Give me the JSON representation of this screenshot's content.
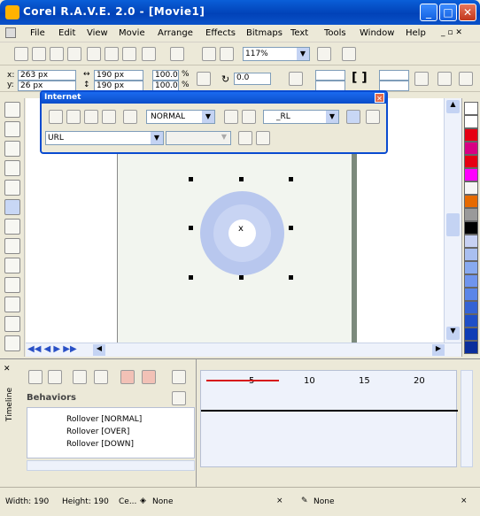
{
  "app": {
    "title": "Corel R.A.V.E. 2.0 - [Movie1]"
  },
  "menu": [
    "File",
    "Edit",
    "View",
    "Movie",
    "Arrange",
    "Effects",
    "Bitmaps",
    "Text",
    "Tools",
    "Window",
    "Help"
  ],
  "toolbar": {
    "zoom": "117%"
  },
  "props": {
    "x": "263 px",
    "y": "26 px",
    "width": "190 px",
    "height": "190 px",
    "scale_x": "100.0",
    "scale_y": "100.0",
    "rotation": "0.0",
    "pct": "%"
  },
  "internet": {
    "title": "Internet",
    "state": "NORMAL",
    "url_type": "URL",
    "url_placeholder": "URL",
    "target": "_RL"
  },
  "timeline": {
    "label": "Timeline",
    "section": "Behaviors",
    "ticks": [
      "5",
      "10",
      "15",
      "20"
    ],
    "rows": [
      "Rollover [NORMAL]",
      "Rollover [OVER]",
      "Rollover [DOWN]"
    ]
  },
  "status": {
    "width": "Width: 190",
    "height": "Height: 190",
    "center": "Ce...",
    "fill": "None",
    "outline": "None"
  },
  "colors": {
    "accent": "#0a52c9",
    "ring_outer": "#b8c7ee",
    "ring_inner": "#8aa2e6"
  },
  "palette": [
    "#ffffff",
    "#ffffff",
    "#e60012",
    "#d80084",
    "#e60012",
    "#ff00ff",
    "#f5f5f5",
    "#e66a00",
    "#9a9a9a",
    "#000000",
    "#c7d1f3",
    "#a9bff0",
    "#88aaf0",
    "#6f95ee",
    "#5b86e8",
    "#3463d4",
    "#1f4fc7",
    "#0f3db6",
    "#0b2e9c"
  ]
}
